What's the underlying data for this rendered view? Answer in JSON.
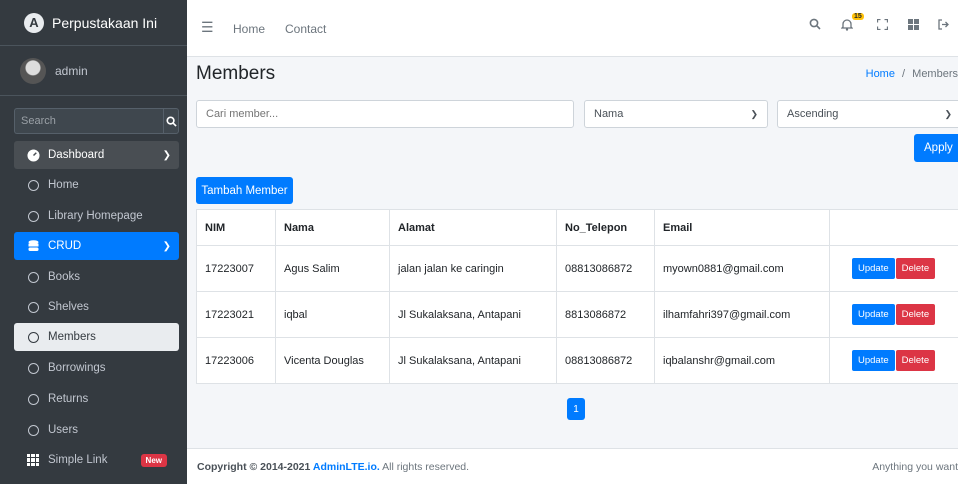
{
  "brand": {
    "name": "Perpustakaan Ini"
  },
  "user": {
    "name": "admin"
  },
  "sidebar": {
    "search_placeholder": "Search",
    "items": [
      {
        "label": "Dashboard"
      },
      {
        "label": "Home"
      },
      {
        "label": "Library Homepage"
      },
      {
        "label": "CRUD"
      },
      {
        "label": "Books"
      },
      {
        "label": "Shelves"
      },
      {
        "label": "Members"
      },
      {
        "label": "Borrowings"
      },
      {
        "label": "Returns"
      },
      {
        "label": "Users"
      },
      {
        "label": "Simple Link",
        "badge": "New"
      }
    ]
  },
  "navbar": {
    "links": [
      "Home",
      "Contact"
    ],
    "notification_count": "15"
  },
  "page": {
    "title": "Members",
    "breadcrumb_home": "Home",
    "breadcrumb_sep": "/",
    "breadcrumb_current": "Members"
  },
  "filters": {
    "search_placeholder": "Cari member...",
    "sort_field": "Nama",
    "sort_order": "Ascending",
    "apply_label": "Apply"
  },
  "add_button": "Tambah Member",
  "table": {
    "headers": [
      "NIM",
      "Nama",
      "Alamat",
      "No_Telepon",
      "Email",
      ""
    ],
    "rows": [
      {
        "nim": "17223007",
        "nama": "Agus Salim",
        "alamat": "jalan jalan ke caringin",
        "telepon": "08813086872",
        "email": "myown0881@gmail.com"
      },
      {
        "nim": "17223021",
        "nama": "iqbal",
        "alamat": "Jl Sukalaksana, Antapani",
        "telepon": "8813086872",
        "email": "ilhamfahri397@gmail.com"
      },
      {
        "nim": "17223006",
        "nama": "Vicenta Douglas",
        "alamat": "Jl Sukalaksana, Antapani",
        "telepon": "08813086872",
        "email": "iqbalanshr@gmail.com"
      }
    ],
    "update_label": "Update",
    "delete_label": "Delete"
  },
  "pagination": {
    "current": "1"
  },
  "footer": {
    "copyright_prefix": "Copyright © 2014-2021 ",
    "brand_link": "AdminLTE.io.",
    "copyright_suffix": " All rights reserved.",
    "right_text": "Anything you want"
  },
  "colors": {
    "primary": "#007bff",
    "danger": "#dc3545",
    "sidebar": "#343a40",
    "warning": "#ffc107"
  }
}
